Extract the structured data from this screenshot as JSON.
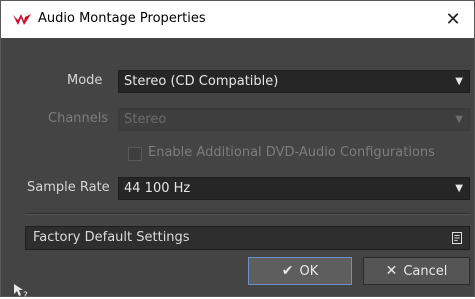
{
  "window": {
    "title": "Audio Montage Properties",
    "close_glyph": "✕"
  },
  "form": {
    "mode": {
      "label": "Mode",
      "value": "Stereo (CD Compatible)"
    },
    "channels": {
      "label": "Channels",
      "value": "Stereo"
    },
    "dvd_option": {
      "label": "Enable Additional DVD-Audio Configurations",
      "checked": false
    },
    "sample_rate": {
      "label": "Sample Rate",
      "value": "44 100 Hz"
    },
    "dropdown_glyph": "▼"
  },
  "preset": {
    "label": "Factory Default Settings"
  },
  "buttons": {
    "ok": {
      "glyph": "✔",
      "label": "OK"
    },
    "cancel": {
      "glyph": "✕",
      "label": "Cancel"
    }
  },
  "icons": [
    "wavelab-logo-icon",
    "close-icon",
    "chevron-down-icon",
    "preset-menu-icon",
    "checkmark-icon",
    "x-icon",
    "help-pointer-icon"
  ]
}
